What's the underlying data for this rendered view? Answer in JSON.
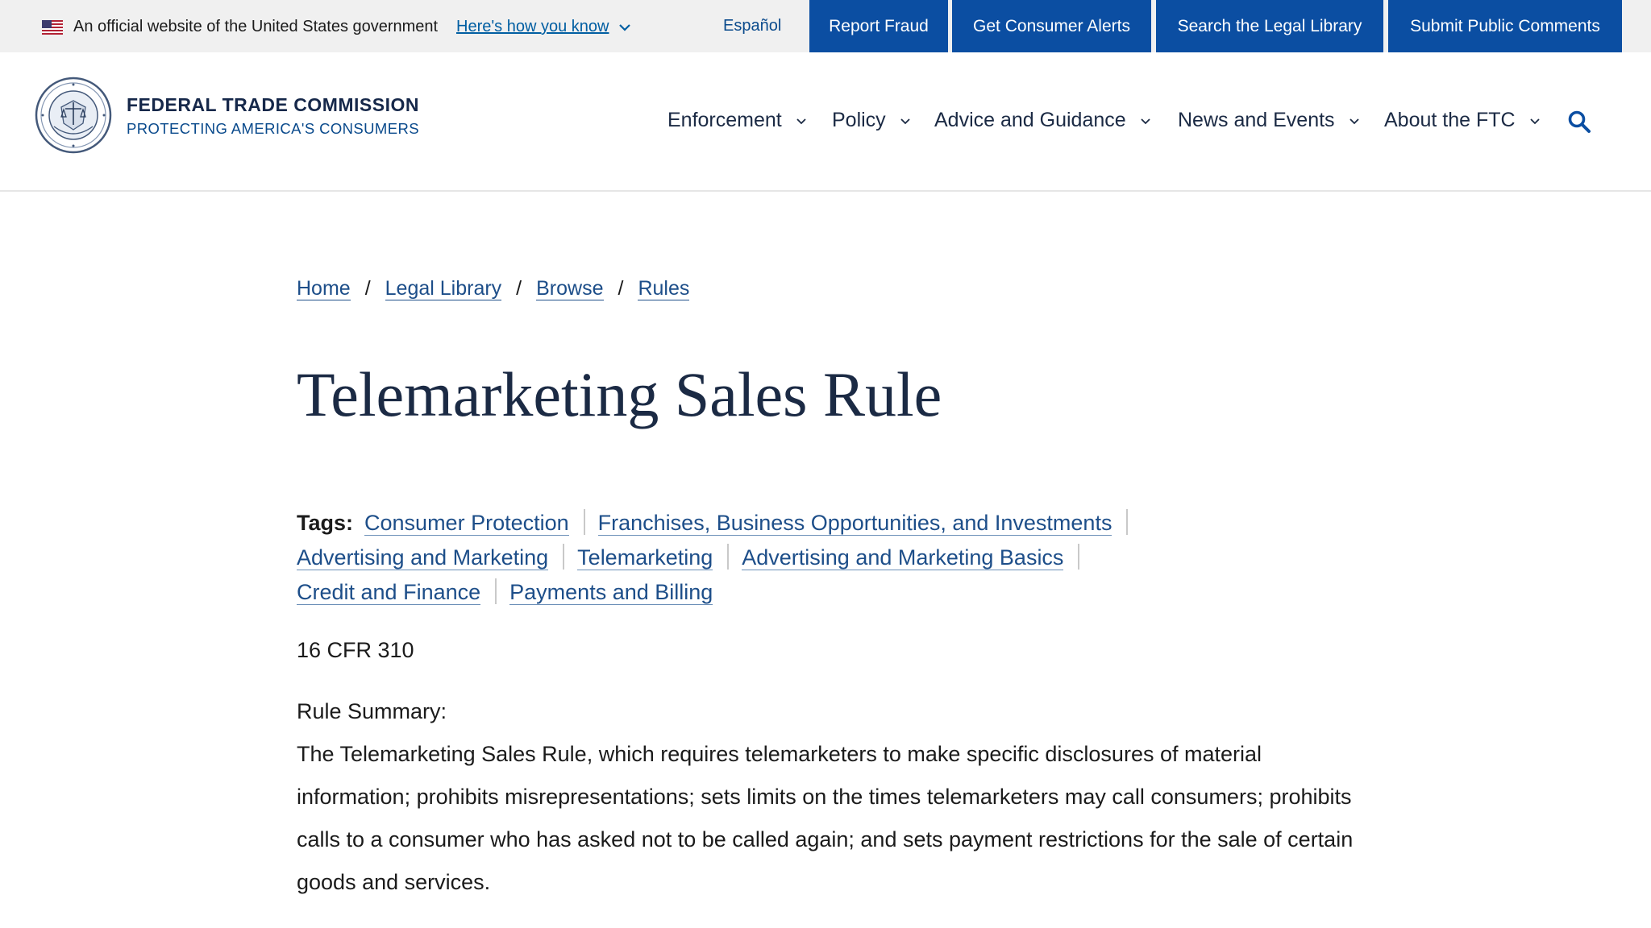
{
  "gov_banner": {
    "official_text": "An official website of the United States government",
    "how_you_know": "Here's how you know",
    "language_link": "Español"
  },
  "utility_nav": [
    {
      "label": "Report Fraud"
    },
    {
      "label": "Get Consumer Alerts"
    },
    {
      "label": "Search the Legal Library"
    },
    {
      "label": "Submit Public Comments"
    }
  ],
  "header": {
    "agency_name": "FEDERAL TRADE COMMISSION",
    "tagline": "PROTECTING AMERICA'S CONSUMERS",
    "nav": [
      {
        "label": "Enforcement"
      },
      {
        "label": "Policy"
      },
      {
        "label": "Advice and Guidance"
      },
      {
        "label": "News and Events"
      },
      {
        "label": "About the FTC"
      }
    ]
  },
  "breadcrumb": [
    {
      "label": "Home"
    },
    {
      "label": "Legal Library"
    },
    {
      "label": "Browse"
    },
    {
      "label": "Rules"
    }
  ],
  "breadcrumb_separator": "/",
  "page": {
    "title": "Telemarketing Sales Rule",
    "tags_label": "Tags:",
    "tags": [
      "Consumer Protection",
      "Franchises, Business Opportunities, and Investments",
      "Advertising and Marketing",
      "Telemarketing",
      "Advertising and Marketing Basics",
      "Credit and Finance",
      "Payments and Billing"
    ],
    "cfr": "16 CFR 310",
    "summary_label": "Rule Summary:",
    "summary_text": "The Telemarketing Sales Rule, which requires telemarketers to make specific disclosures of material information; prohibits misrepresentations; sets limits on the times telemarketers may call consumers; prohibits calls to a consumer who has asked not to be called again; and sets payment restrictions for the sale of certain goods and services."
  },
  "icons": {
    "flag": "us-flag-icon",
    "how_chevron": "chevron-down-icon",
    "nav_chevron": "chevron-down-icon",
    "search": "search-icon",
    "seal": "ftc-seal-logo"
  },
  "colors": {
    "banner_bg": "#f0f0f0",
    "utility_button_bg": "#0b4ea2",
    "link": "#1d4e89",
    "heading": "#1b2a44"
  }
}
